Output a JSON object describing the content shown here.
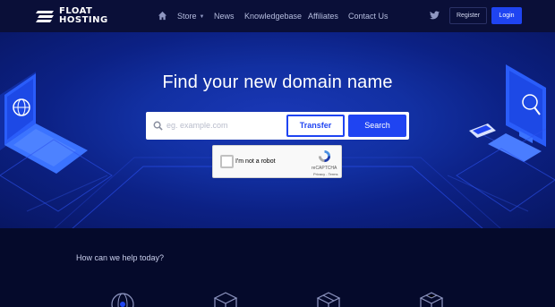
{
  "header": {
    "logo_line1": "FLOAT",
    "logo_line2": "HOSTING",
    "nav": {
      "store": "Store",
      "news": "News",
      "knowledgebase": "Knowledgebase",
      "affiliates": "Affiliates",
      "contact": "Contact Us"
    },
    "register_label": "Register",
    "login_label": "Login"
  },
  "hero": {
    "title": "Find your new domain name",
    "search_placeholder": "eg. example.com",
    "transfer_label": "Transfer",
    "search_label": "Search"
  },
  "captcha": {
    "label": "I'm not a robot",
    "brand": "reCAPTCHA",
    "links": "Privacy - Terms"
  },
  "help": {
    "title": "How can we help today?"
  },
  "colors": {
    "accent": "#1f44f2",
    "header_bg": "#0a0f38",
    "page_bg": "#050a2b"
  }
}
